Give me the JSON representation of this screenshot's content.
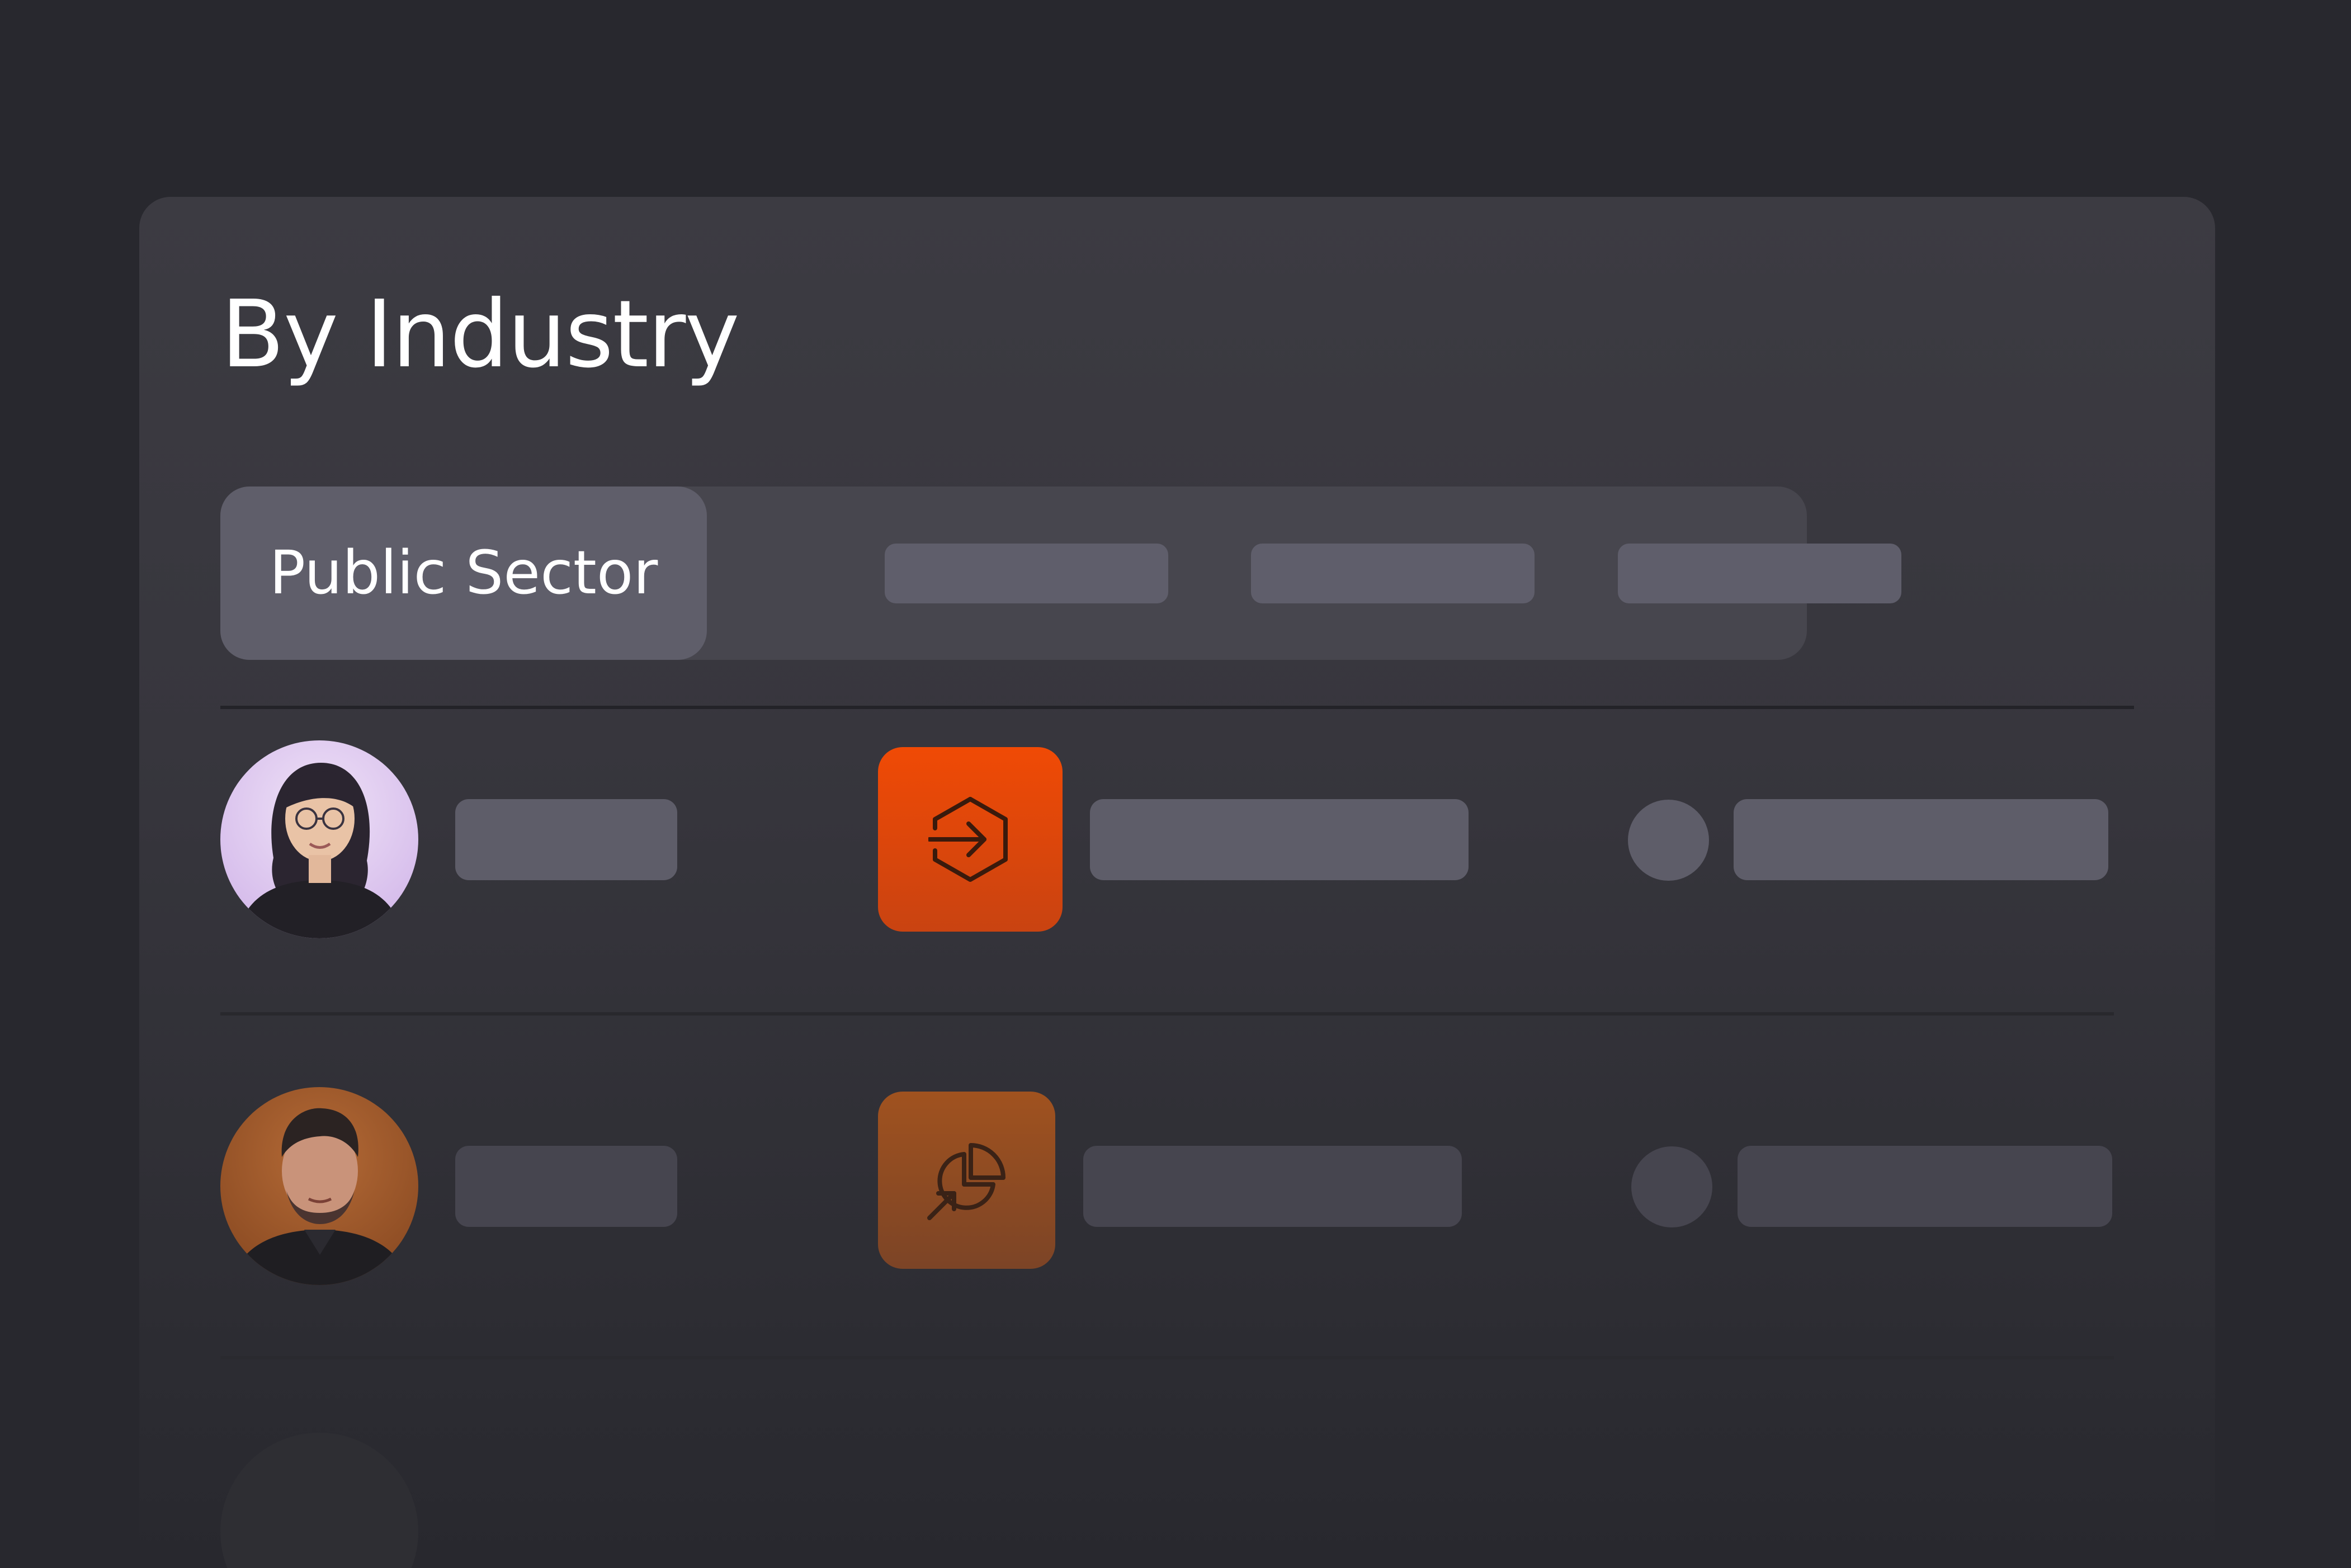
{
  "header": {
    "title": "By Industry"
  },
  "tabs": {
    "active_label": "Public Sector"
  },
  "rows": [
    {
      "avatar_icon": "person-avatar-woman",
      "app_icon": "hexagon-arrow-in-icon",
      "app_color": "#ec4b07"
    },
    {
      "avatar_icon": "person-avatar-man",
      "app_icon": "pie-chart-arrow-icon",
      "app_color": "#9a4a1c"
    }
  ],
  "colors": {
    "background": "#28282e",
    "card": "#3c3b42",
    "accent": "#ec4b07",
    "placeholder": "#5f5e6b"
  }
}
